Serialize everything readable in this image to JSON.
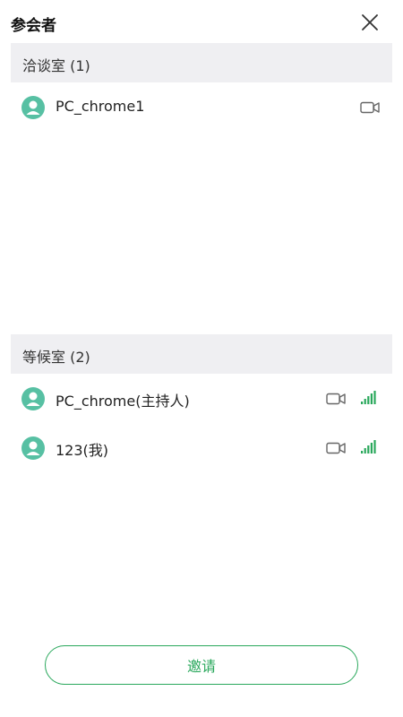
{
  "header": {
    "title": "参会者"
  },
  "sections": [
    {
      "label": "洽谈室 (1)",
      "participants": [
        {
          "name": "PC_chrome1",
          "icons": [
            "user-avatar-icon",
            "camera-icon"
          ]
        }
      ]
    },
    {
      "label": "等候室 (2)",
      "participants": [
        {
          "name": "PC_chrome(主持人)",
          "icons": [
            "user-avatar-icon",
            "camera-icon",
            "signal-strength-icon"
          ]
        },
        {
          "name": "123(我)",
          "icons": [
            "user-avatar-icon",
            "camera-icon",
            "signal-strength-icon"
          ]
        }
      ]
    }
  ],
  "footer": {
    "invite_label": "邀请"
  },
  "colors": {
    "accent": "#2aa85c",
    "avatar": "#57c0a3",
    "section_bg": "#efeff2",
    "signal": "#2aa85c"
  }
}
